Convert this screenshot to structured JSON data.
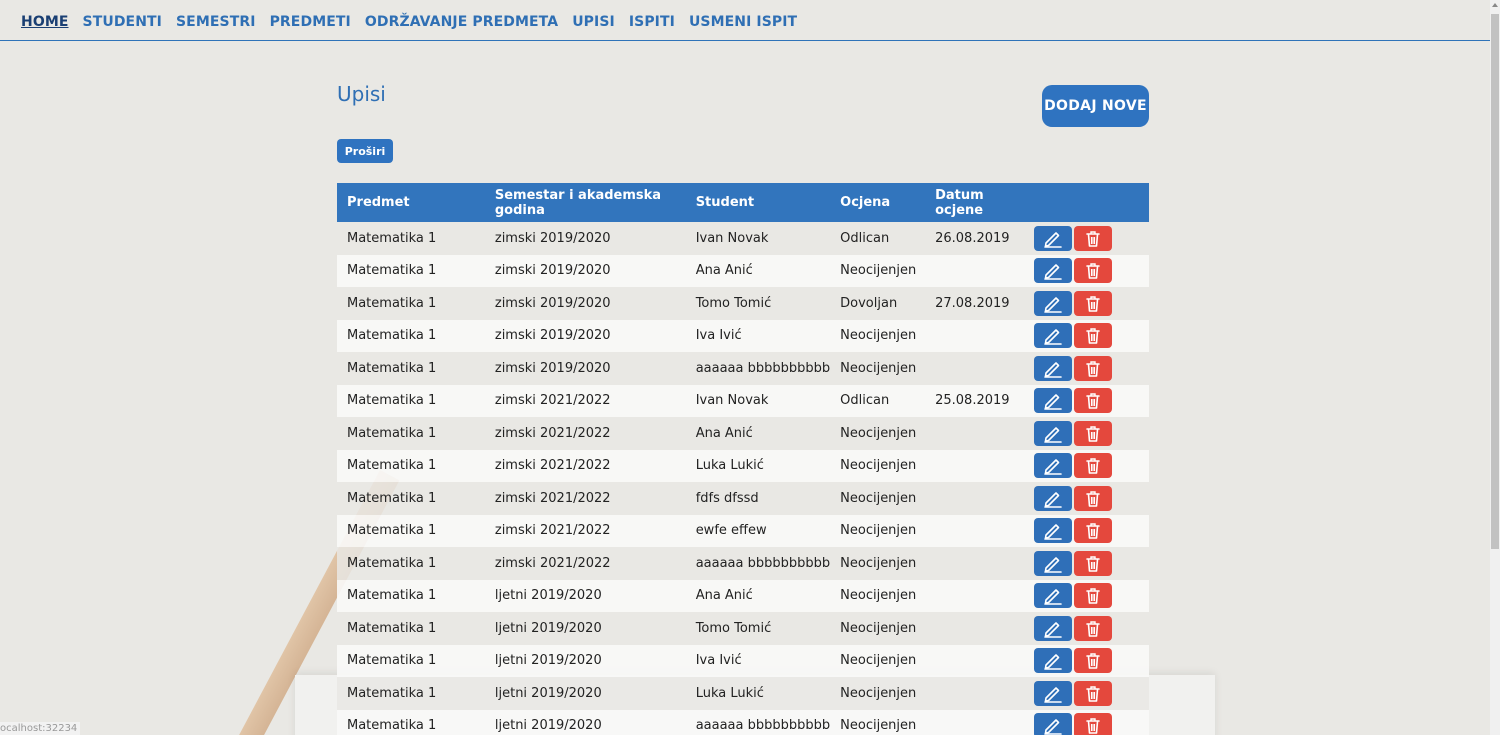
{
  "nav": {
    "items": [
      "HOME",
      "STUDENTI",
      "SEMESTRI",
      "PREDMETI",
      "ODRŽAVANJE PREDMETA",
      "UPISI",
      "ISPITI",
      "USMENI ISPIT"
    ],
    "active": "HOME"
  },
  "page": {
    "title": "Upisi",
    "add_button": "DODAJ NOVE",
    "expand_button": "Proširi"
  },
  "table": {
    "headers": [
      "Predmet",
      "Semestar i akademska godina",
      "Student",
      "Ocjena",
      "Datum ocjene",
      ""
    ],
    "rows": [
      [
        "Matematika 1",
        "zimski 2019/2020",
        "Ivan Novak",
        "Odlican",
        "26.08.2019"
      ],
      [
        "Matematika 1",
        "zimski 2019/2020",
        "Ana Anić",
        "Neocijenjen",
        ""
      ],
      [
        "Matematika 1",
        "zimski 2019/2020",
        "Tomo Tomić",
        "Dovoljan",
        "27.08.2019"
      ],
      [
        "Matematika 1",
        "zimski 2019/2020",
        "Iva Ivić",
        "Neocijenjen",
        ""
      ],
      [
        "Matematika 1",
        "zimski 2019/2020",
        "aaaaaa bbbbbbbbbb",
        "Neocijenjen",
        ""
      ],
      [
        "Matematika 1",
        "zimski 2021/2022",
        "Ivan Novak",
        "Odlican",
        "25.08.2019"
      ],
      [
        "Matematika 1",
        "zimski 2021/2022",
        "Ana Anić",
        "Neocijenjen",
        ""
      ],
      [
        "Matematika 1",
        "zimski 2021/2022",
        "Luka Lukić",
        "Neocijenjen",
        ""
      ],
      [
        "Matematika 1",
        "zimski 2021/2022",
        "fdfs dfssd",
        "Neocijenjen",
        ""
      ],
      [
        "Matematika 1",
        "zimski 2021/2022",
        "ewfe effew",
        "Neocijenjen",
        ""
      ],
      [
        "Matematika 1",
        "zimski 2021/2022",
        "aaaaaa bbbbbbbbbb",
        "Neocijenjen",
        ""
      ],
      [
        "Matematika 1",
        "ljetni 2019/2020",
        "Ana Anić",
        "Neocijenjen",
        ""
      ],
      [
        "Matematika 1",
        "ljetni 2019/2020",
        "Tomo Tomić",
        "Neocijenjen",
        ""
      ],
      [
        "Matematika 1",
        "ljetni 2019/2020",
        "Iva Ivić",
        "Neocijenjen",
        ""
      ],
      [
        "Matematika 1",
        "ljetni 2019/2020",
        "Luka Lukić",
        "Neocijenjen",
        ""
      ],
      [
        "Matematika 1",
        "ljetni 2019/2020",
        "aaaaaa bbbbbbbbbb",
        "Neocijenjen",
        ""
      ]
    ],
    "row_actions": {
      "edit_icon": "pencil-icon",
      "delete_icon": "trash-icon"
    }
  },
  "status_bar": "ocalhost:32234",
  "colors": {
    "primary": "#2f73c0",
    "danger": "#e4483d",
    "header": "#3275bd",
    "text_link": "#2f6fb4"
  }
}
